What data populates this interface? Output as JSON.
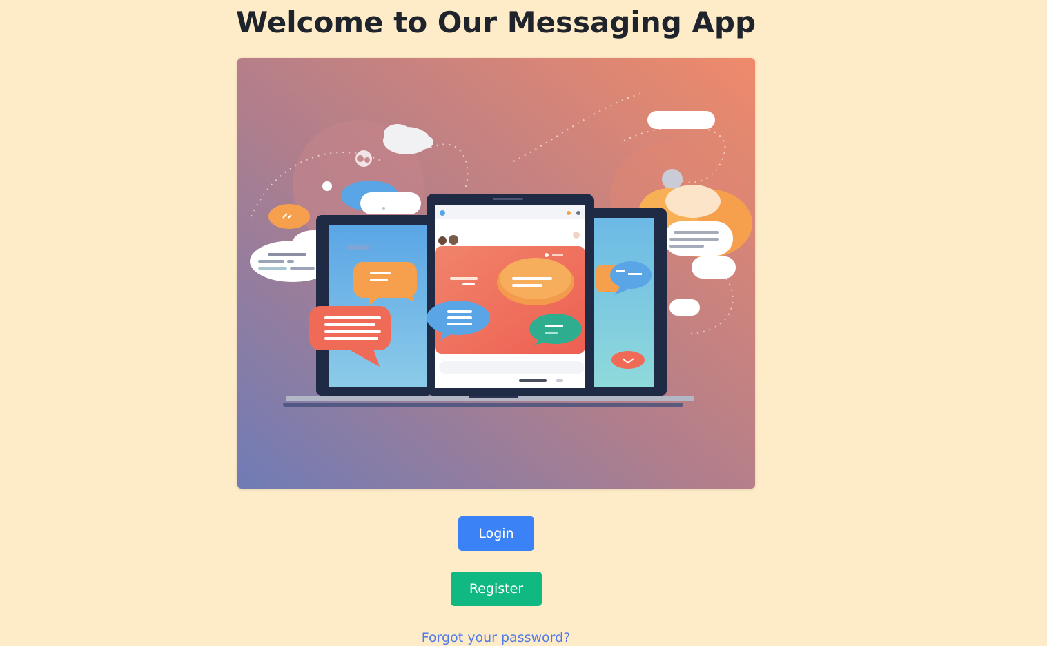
{
  "page": {
    "title": "Welcome to Our Messaging App"
  },
  "hero_image": {
    "description_icon": "messaging-illustration",
    "colors": {
      "gradient_start": "#7b7aa8",
      "gradient_end": "#ef8a6a",
      "device_frame": "#1f2a44",
      "bubble_orange": "#f6a04d",
      "bubble_red": "#ef6b57",
      "bubble_blue": "#5aa5e6",
      "bubble_green": "#2fae8f"
    }
  },
  "actions": {
    "login_label": "Login",
    "register_label": "Register",
    "forgot_label": "Forgot your password?"
  },
  "colors": {
    "background": "#feebc8",
    "login_button": "#3b82f6",
    "register_button": "#10b981",
    "link": "#4f79e8"
  }
}
